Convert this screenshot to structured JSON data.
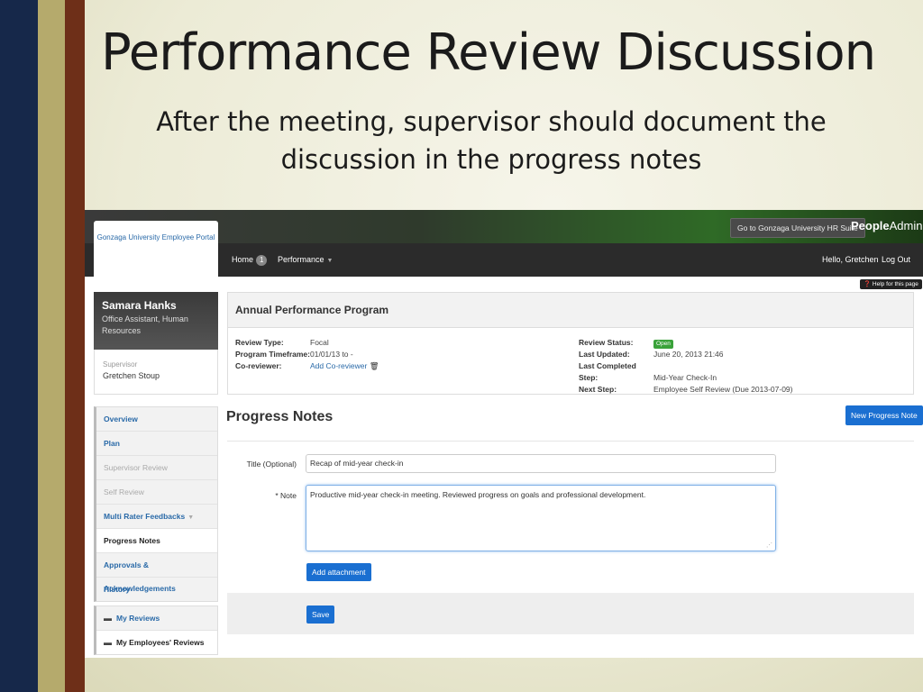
{
  "slide": {
    "title": "Performance Review Discussion",
    "subtitle": "After the meeting, supervisor should document the discussion in the progress notes"
  },
  "app": {
    "portal_tab": "Gonzaga University Employee Portal",
    "hr_suite_button": "Go to Gonzaga University HR Suite",
    "brand_bold": "People",
    "brand_regular": "Admin",
    "nav": {
      "home": "Home",
      "home_badge": "1",
      "performance": "Performance",
      "greeting": "Hello, Gretchen",
      "logout": "Log Out"
    },
    "help": "Help for this page"
  },
  "profile": {
    "name": "Samara Hanks",
    "role": "Office Assistant, Human Resources",
    "supervisor_label": "Supervisor",
    "supervisor_name": "Gretchen Stoup"
  },
  "sidebar": {
    "items": [
      {
        "label": "Overview",
        "state": "link"
      },
      {
        "label": "Plan",
        "state": "link"
      },
      {
        "label": "Supervisor Review",
        "state": "disabled"
      },
      {
        "label": "Self Review",
        "state": "disabled"
      },
      {
        "label": "Multi Rater Feedbacks",
        "state": "link"
      },
      {
        "label": "Progress Notes",
        "state": "active"
      },
      {
        "label": "Approvals & Acknowledgements",
        "state": "link"
      },
      {
        "label": "History",
        "state": "link"
      }
    ],
    "reviews": [
      {
        "label": "My Reviews",
        "state": "link"
      },
      {
        "label": "My Employees' Reviews",
        "state": "active"
      }
    ]
  },
  "program": {
    "title": "Annual Performance Program",
    "review_type_label": "Review Type:",
    "review_type": "Focal",
    "timeframe_label": "Program Timeframe:",
    "timeframe": "01/01/13 to -",
    "coreviewer_label": "Co-reviewer:",
    "coreviewer_link": "Add Co-reviewer",
    "status_label": "Review Status:",
    "status": "Open",
    "last_updated_label": "Last Updated:",
    "last_updated": "June 20, 2013 21:46",
    "last_step_label": "Last Completed Step:",
    "last_step": "Mid-Year Check-In",
    "next_step_label": "Next Step:",
    "next_step": "Employee Self Review (Due 2013-07-09)"
  },
  "progress_notes": {
    "heading": "Progress Notes",
    "new_button": "New Progress Note",
    "title_label": "Title (Optional)",
    "title_value": "Recap of mid-year check-in",
    "note_label": "* Note",
    "note_value": "Productive mid-year check-in meeting.  Reviewed progress on goals and professional development.",
    "attachment_button": "Add attachment",
    "save_button": "Save"
  },
  "colors": {
    "accent_blue": "#1a6fd1",
    "link_blue": "#2a6aa8",
    "status_green": "#3aa23a",
    "stripe_navy": "#16284a",
    "stripe_olive": "#b5aa6c",
    "stripe_brown": "#6e2f18"
  }
}
